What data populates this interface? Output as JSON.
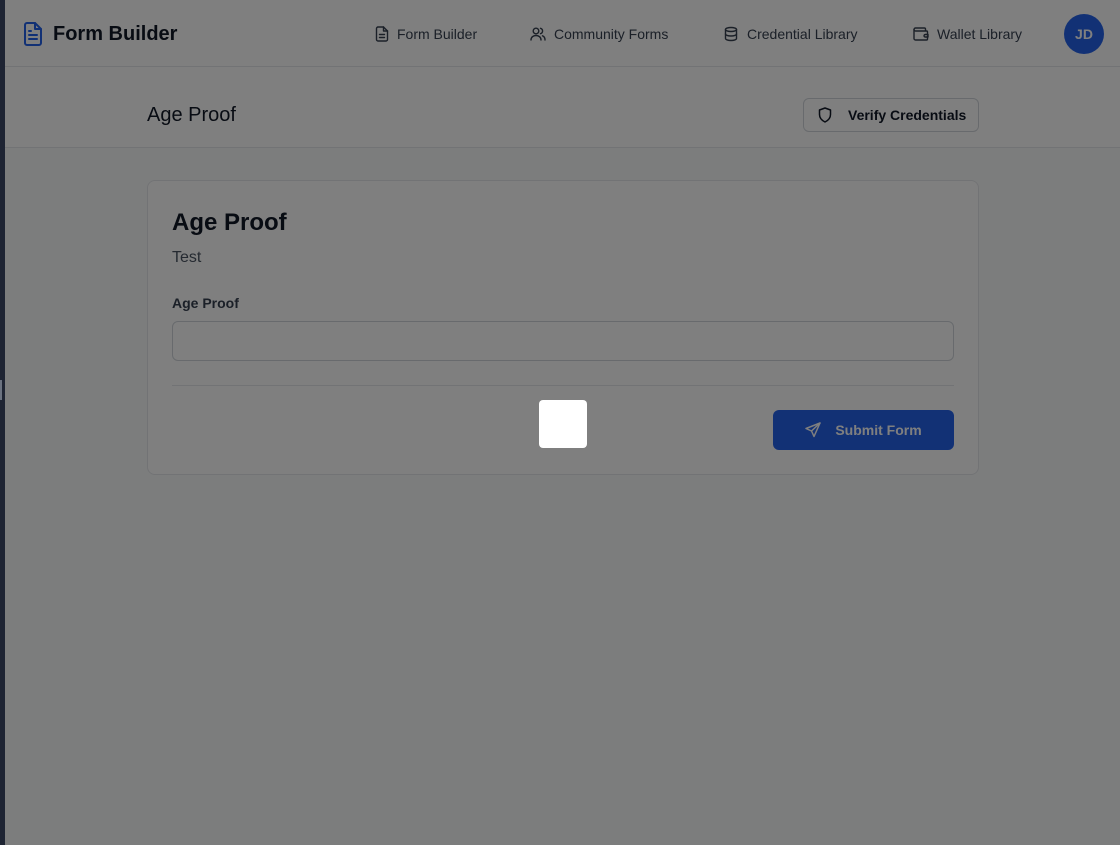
{
  "app": {
    "name": "Form Builder",
    "brand_color": "#2563eb"
  },
  "nav": {
    "links": [
      {
        "label": "Form Builder",
        "icon": "file-text-icon"
      },
      {
        "label": "Community Forms",
        "icon": "users-icon"
      },
      {
        "label": "Credential Library",
        "icon": "database-icon"
      },
      {
        "label": "Wallet Library",
        "icon": "wallet-icon"
      }
    ],
    "avatar_initials": "JD"
  },
  "subheader": {
    "title": "Age Proof",
    "verify_label": "Verify Credentials"
  },
  "form": {
    "title": "Age Proof",
    "description": "Test",
    "fields": [
      {
        "label": "Age Proof",
        "value": "",
        "placeholder": ""
      }
    ],
    "submit_label": "Submit Form"
  },
  "overlay": {
    "visible": true
  }
}
